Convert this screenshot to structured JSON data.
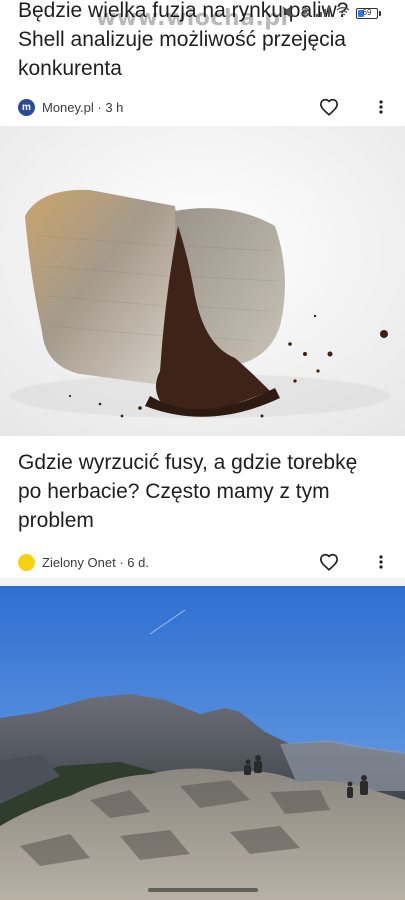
{
  "watermark": "www.wiocha.pl",
  "status_bar": {
    "battery": "69"
  },
  "articles": [
    {
      "headline_line_1": "Będzie wielka fuzja na rynku paliw?",
      "headline_line_2": "Shell analizuje możliwość przejęcia",
      "headline_line_3": "konkurenta",
      "source_initial": "m",
      "source": "Money.pl · 3 h",
      "like_icon": "heart-outline-icon",
      "menu_icon": "more-vertical-icon"
    },
    {
      "image": "tea-bag-with-spilled-leaves-photo",
      "headline_line_1": "Gdzie wyrzucić fusy, a gdzie torebkę",
      "headline_line_2": "po herbacie? Często mamy z tym",
      "headline_line_3": "problem",
      "source": "Zielony Onet · 6 d.",
      "like_icon": "heart-outline-icon",
      "menu_icon": "more-vertical-icon"
    },
    {
      "image": "tatra-mountains-hikers-photo"
    }
  ],
  "colors": {
    "background": "#ffffff",
    "divider": "#f1f3f4",
    "money_logo": "#2a4a9a",
    "onet_logo": "#f5d10f"
  }
}
